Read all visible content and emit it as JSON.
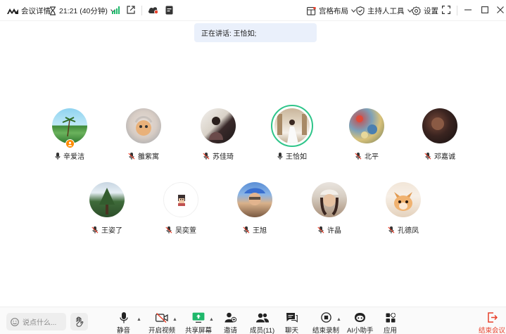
{
  "topbar": {
    "meeting_details": "会议详情",
    "time": "21:21 (40分钟)",
    "layout": "宫格布局",
    "host_tools": "主持人工具",
    "settings": "设置"
  },
  "speaking_banner": "正在讲话: 王恰如;",
  "participants_row1": [
    {
      "name": "辛爱洁",
      "mic": "on",
      "host": true
    },
    {
      "name": "雒紫寓",
      "mic": "muted"
    },
    {
      "name": "苏佳琦",
      "mic": "muted"
    },
    {
      "name": "王恰如",
      "mic": "on",
      "active": true
    },
    {
      "name": "北平",
      "mic": "muted"
    },
    {
      "name": "邓嘉诚",
      "mic": "muted"
    }
  ],
  "participants_row2": [
    {
      "name": "王姿了",
      "mic": "muted"
    },
    {
      "name": "吴奕萱",
      "mic": "muted"
    },
    {
      "name": "王旭",
      "mic": "muted"
    },
    {
      "name": "许晶",
      "mic": "muted"
    },
    {
      "name": "孔德凤",
      "mic": "muted"
    }
  ],
  "bottombar": {
    "chat_placeholder": "说点什么...",
    "mute": "静音",
    "start_video": "开启视频",
    "share_screen": "共享屏幕",
    "invite": "邀请",
    "members": "成员(11)",
    "chat": "聊天",
    "stop_recording": "结束录制",
    "ai_assistant": "AI小助手",
    "apps": "应用",
    "end_meeting": "结束会议"
  },
  "colors": {
    "active_ring": "#2fc58a",
    "end_red": "#e8402b",
    "signal_green": "#1fb86b",
    "host_badge": "#ff8a00",
    "banner_bg": "#eaf0fb"
  }
}
